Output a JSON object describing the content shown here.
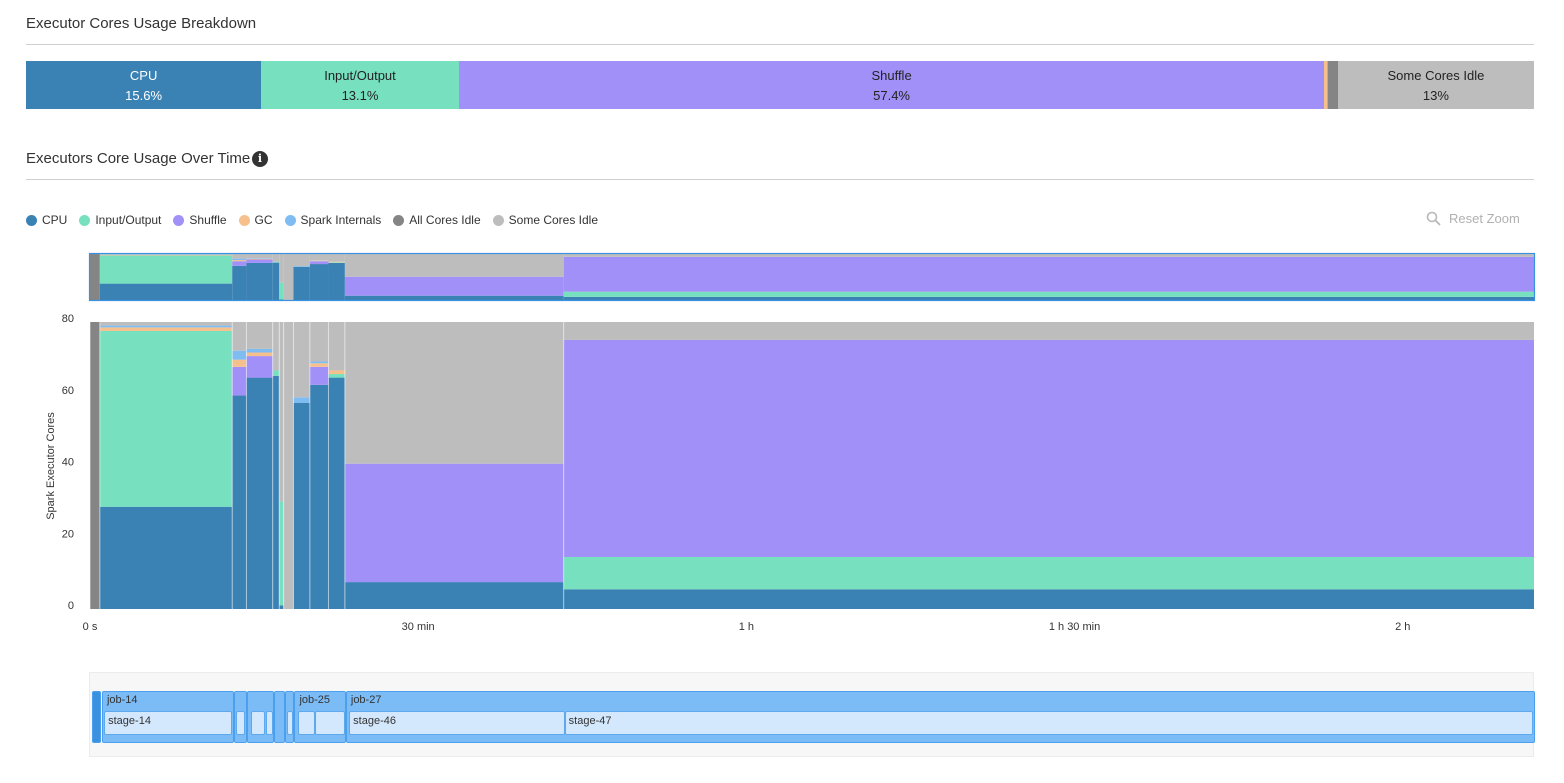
{
  "breakdown": {
    "title": "Executor Cores Usage Breakdown",
    "segments": [
      {
        "name": "CPU",
        "pct": "15.6%",
        "value": 15.6,
        "color": "#3b82b4",
        "text": "#ffffff"
      },
      {
        "name": "Input/Output",
        "pct": "13.1%",
        "value": 13.1,
        "color": "#77e0bf",
        "text": "#222222"
      },
      {
        "name": "Shuffle",
        "pct": "57.4%",
        "value": 57.4,
        "color": "#a190f8",
        "text": "#222222"
      },
      {
        "name": "",
        "pct": "",
        "value": 0.15,
        "color": "#f6c08d",
        "text": "#222222"
      },
      {
        "name": "",
        "pct": "",
        "value": 0.1,
        "color": "#7fbcf2",
        "text": "#222222"
      },
      {
        "name": "",
        "pct": "",
        "value": 0.65,
        "color": "#858585",
        "text": "#222222"
      },
      {
        "name": "Some Cores Idle",
        "pct": "13%",
        "value": 13.0,
        "color": "#bdbdbd",
        "text": "#222222"
      }
    ]
  },
  "over_time": {
    "title": "Executors Core Usage Over Time",
    "info_icon": "info-icon",
    "reset_zoom": "Reset Zoom",
    "reset_icon": "magnifier-icon"
  },
  "legend": [
    {
      "label": "CPU",
      "color": "#3b82b4"
    },
    {
      "label": "Input/Output",
      "color": "#77e0bf"
    },
    {
      "label": "Shuffle",
      "color": "#a190f8"
    },
    {
      "label": "GC",
      "color": "#f6c08d"
    },
    {
      "label": "Spark Internals",
      "color": "#7fbcf2"
    },
    {
      "label": "All Cores Idle",
      "color": "#858585"
    },
    {
      "label": "Some Cores Idle",
      "color": "#bdbdbd"
    }
  ],
  "chart_data": {
    "type": "area",
    "ylabel": "Spark Executor Cores",
    "ylim": [
      0,
      80
    ],
    "yticks": [
      0,
      20,
      40,
      60,
      80
    ],
    "xlim_min": [
      0,
      132
    ],
    "xticks": [
      {
        "min": 0,
        "label": "0 s"
      },
      {
        "min": 30,
        "label": "30 min"
      },
      {
        "min": 60,
        "label": "1 h"
      },
      {
        "min": 90,
        "label": "1 h 30 min"
      },
      {
        "min": 120,
        "label": "2 h"
      }
    ],
    "stack_order": [
      "cpu",
      "io",
      "shuffle",
      "gc",
      "internals",
      "all_idle",
      "some_idle"
    ],
    "colors": {
      "cpu": "#3b82b4",
      "io": "#77e0bf",
      "shuffle": "#a190f8",
      "gc": "#f6c08d",
      "internals": "#7fbcf2",
      "all_idle": "#858585",
      "some_idle": "#bdbdbd"
    },
    "segments": [
      {
        "start": 0,
        "end": 0.9,
        "cpu": 0,
        "io": 0,
        "shuffle": 0,
        "gc": 0,
        "internals": 0,
        "all_idle": 80,
        "some_idle": 0
      },
      {
        "start": 0.9,
        "end": 13,
        "cpu": 28.5,
        "io": 49,
        "shuffle": 0,
        "gc": 1,
        "internals": 0.5,
        "all_idle": 0,
        "some_idle": 1
      },
      {
        "start": 13,
        "end": 14.3,
        "cpu": 59.5,
        "io": 0,
        "shuffle": 8,
        "gc": 2,
        "internals": 2.5,
        "all_idle": 0,
        "some_idle": 8
      },
      {
        "start": 14.3,
        "end": 16.7,
        "cpu": 64.5,
        "io": 0,
        "shuffle": 6,
        "gc": 1,
        "internals": 1,
        "all_idle": 0,
        "some_idle": 7.5
      },
      {
        "start": 16.7,
        "end": 17.3,
        "cpu": 65,
        "io": 1.5,
        "shuffle": 0,
        "gc": 0,
        "internals": 0,
        "all_idle": 0,
        "some_idle": 13.5
      },
      {
        "start": 17.3,
        "end": 17.7,
        "cpu": 1,
        "io": 29,
        "shuffle": 0,
        "gc": 0,
        "internals": 0,
        "all_idle": 0,
        "some_idle": 50
      },
      {
        "start": 17.7,
        "end": 18.6,
        "cpu": 0,
        "io": 0,
        "shuffle": 0,
        "gc": 0,
        "internals": 0,
        "all_idle": 0,
        "some_idle": 80
      },
      {
        "start": 18.6,
        "end": 20.1,
        "cpu": 57.5,
        "io": 0,
        "shuffle": 0,
        "gc": 0,
        "internals": 1.5,
        "all_idle": 0,
        "some_idle": 21
      },
      {
        "start": 20.1,
        "end": 21.8,
        "cpu": 62.5,
        "io": 0,
        "shuffle": 5,
        "gc": 1,
        "internals": 0.5,
        "all_idle": 0,
        "some_idle": 11
      },
      {
        "start": 21.8,
        "end": 23.3,
        "cpu": 64.5,
        "io": 1,
        "shuffle": 0,
        "gc": 1,
        "internals": 0,
        "all_idle": 0,
        "some_idle": 13.5
      },
      {
        "start": 23.3,
        "end": 43.3,
        "cpu": 7.5,
        "io": 0,
        "shuffle": 33,
        "gc": 0,
        "internals": 0,
        "all_idle": 0,
        "some_idle": 39.5
      },
      {
        "start": 43.3,
        "end": 132,
        "cpu": 5.5,
        "io": 9,
        "shuffle": 60.5,
        "gc": 0,
        "internals": 0,
        "all_idle": 0,
        "some_idle": 5
      }
    ]
  },
  "timeline": {
    "jobs": [
      {
        "label": "",
        "start": 0.1,
        "end": 0.9,
        "dark": true
      },
      {
        "label": "job-14",
        "start": 1.0,
        "end": 13.1
      },
      {
        "label": "",
        "start": 13.1,
        "end": 14.3
      },
      {
        "label": "",
        "start": 14.3,
        "end": 16.7
      },
      {
        "label": "",
        "start": 16.7,
        "end": 17.7
      },
      {
        "label": "",
        "start": 17.7,
        "end": 18.6
      },
      {
        "label": "job-25",
        "start": 18.6,
        "end": 23.3
      },
      {
        "label": "job-27",
        "start": 23.3,
        "end": 132
      }
    ],
    "stages": [
      {
        "label": "stage-14",
        "start": 1.2,
        "end": 12.9
      },
      {
        "label": "",
        "start": 13.3,
        "end": 14.1
      },
      {
        "label": "",
        "start": 14.6,
        "end": 15.9
      },
      {
        "label": "",
        "start": 16.0,
        "end": 16.6
      },
      {
        "label": "",
        "start": 17.9,
        "end": 18.5
      },
      {
        "label": "",
        "start": 18.9,
        "end": 20.5
      },
      {
        "label": "",
        "start": 20.5,
        "end": 23.2
      },
      {
        "label": "stage-46",
        "start": 23.6,
        "end": 43.3
      },
      {
        "label": "stage-47",
        "start": 43.3,
        "end": 131.8
      }
    ]
  }
}
